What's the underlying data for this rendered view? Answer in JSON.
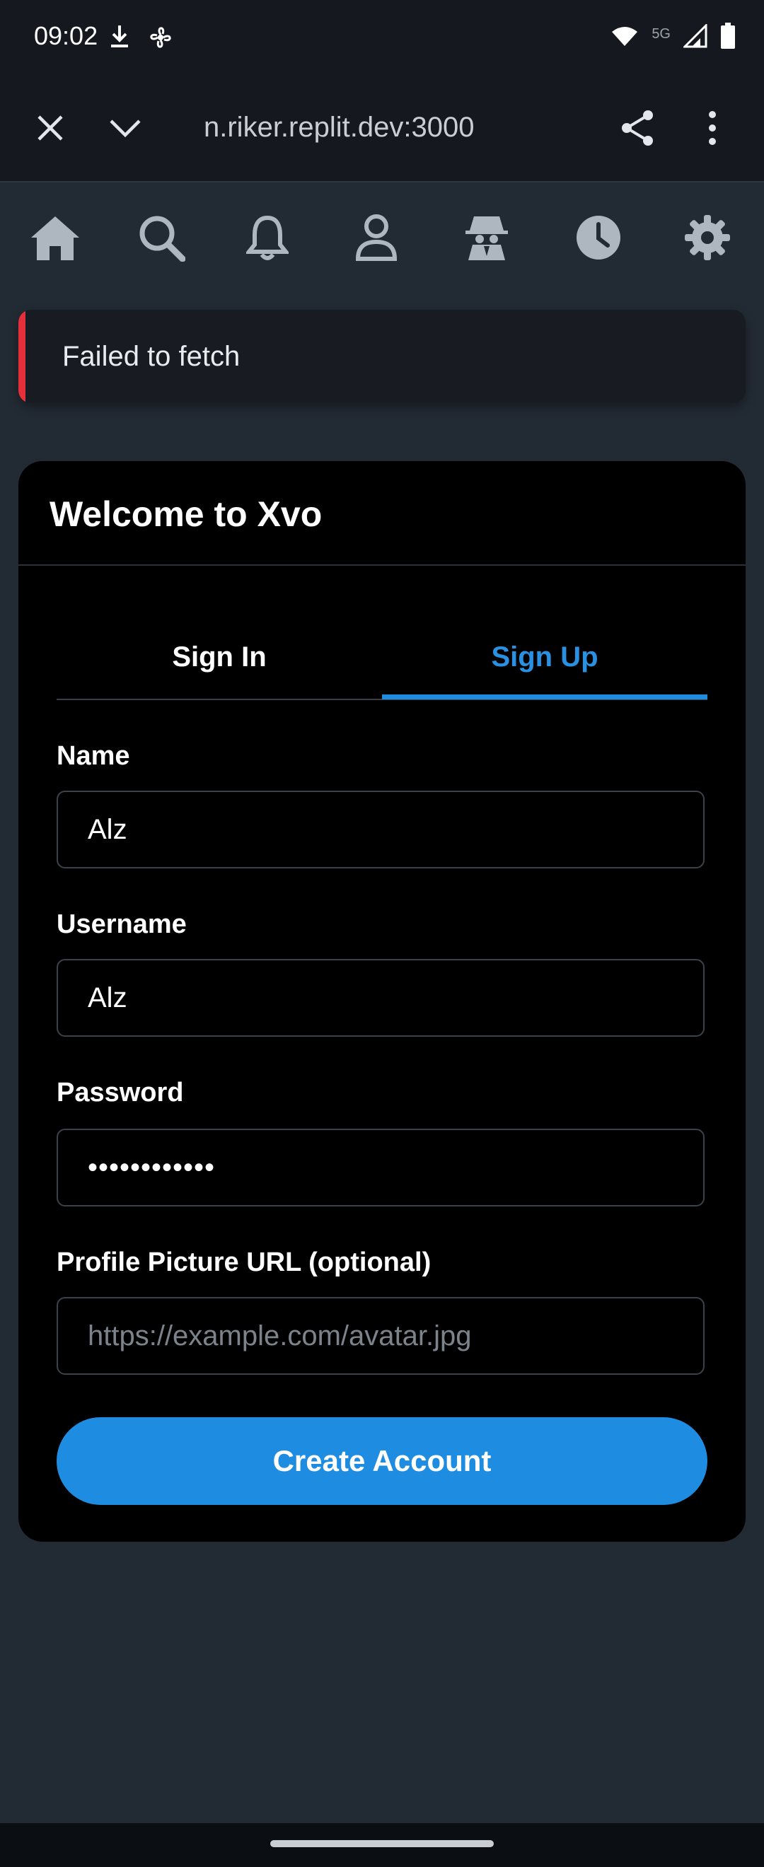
{
  "status_bar": {
    "time": "09:02",
    "network_label": "5G",
    "icons": [
      "download-icon",
      "fan-icon",
      "wifi-icon",
      "signal-icon",
      "battery-icon"
    ]
  },
  "browser": {
    "url": "n.riker.replit.dev:3000",
    "icons": [
      "close-icon",
      "chevron-down-icon",
      "share-icon",
      "more-vert-icon"
    ]
  },
  "nav": {
    "icons": [
      "home-icon",
      "search-icon",
      "bell-icon",
      "user-icon",
      "spy-icon",
      "clock-icon",
      "gear-icon"
    ]
  },
  "alert": {
    "message": "Failed to fetch",
    "accent_color": "#e5303c"
  },
  "card": {
    "title": "Welcome to Xvo",
    "tabs": [
      {
        "label": "Sign In",
        "active": false
      },
      {
        "label": "Sign Up",
        "active": true
      }
    ],
    "fields": {
      "name": {
        "label": "Name",
        "value": "Alz"
      },
      "username": {
        "label": "Username",
        "value": "Alz"
      },
      "password": {
        "label": "Password",
        "value": "••••••••••••"
      },
      "avatar": {
        "label": "Profile Picture URL (optional)",
        "placeholder": "https://example.com/avatar.jpg",
        "value": ""
      }
    },
    "submit_label": "Create Account",
    "accent_color": "#1e8ce0"
  }
}
